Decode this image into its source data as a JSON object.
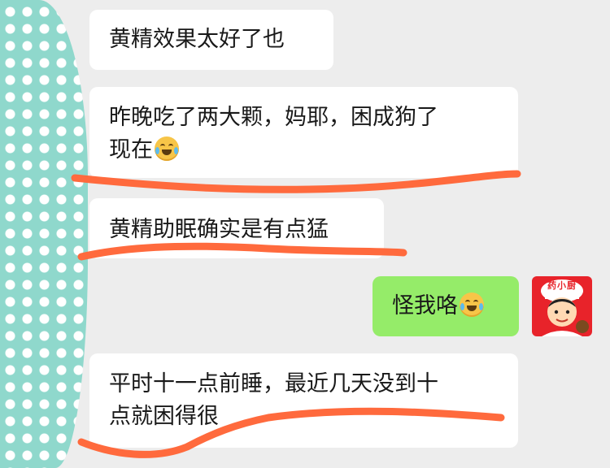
{
  "chat": {
    "messages": [
      {
        "side": "left",
        "text": "黄精效果太好了也"
      },
      {
        "side": "left",
        "line1": "昨晚吃了两大颗，妈耶，困成狗了",
        "line2": "现在",
        "emoji": "laughing-crying-emoji"
      },
      {
        "side": "left",
        "text": "黄精助眠确实是有点猛"
      },
      {
        "side": "right",
        "text": "怪我咯",
        "emoji": "crying-emoji"
      },
      {
        "side": "left",
        "line1": "平时十一点前睡，最近几天没到十",
        "line2": "点就困得很"
      }
    ],
    "self_avatar": {
      "label": "药小厨",
      "icon": "chef-cartoon-avatar"
    }
  },
  "colors": {
    "background": "#ededed",
    "incoming_bubble": "#ffffff",
    "outgoing_bubble": "#95ec69",
    "annotation_stroke": "#ff6a3d",
    "strip_color": "#8fd8cc"
  }
}
